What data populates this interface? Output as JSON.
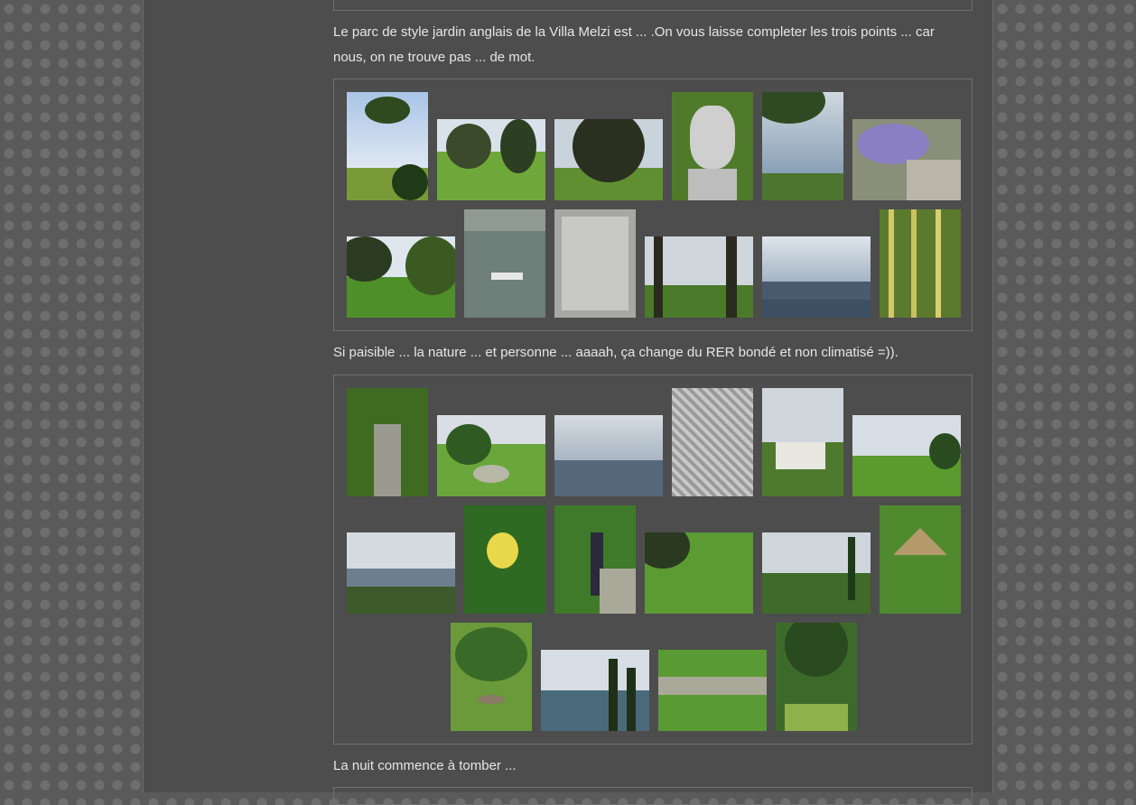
{
  "paragraphs": {
    "p1": "Le parc de style jardin anglais de la Villa Melzi est  ... .On vous laisse completer les trois points ... car nous, on ne trouve pas ... de mot.",
    "p2": "Si paisible ... la nature ... et personne ... aaaah, ça change du RER bondé et non climatisé =)).",
    "p3": "La nuit commence à tomber ..."
  },
  "colors": {
    "background": "#5a5a5a",
    "column": "#4d4d4d",
    "text": "#e6e6e6",
    "gallery_border": "#6f6f6f"
  }
}
